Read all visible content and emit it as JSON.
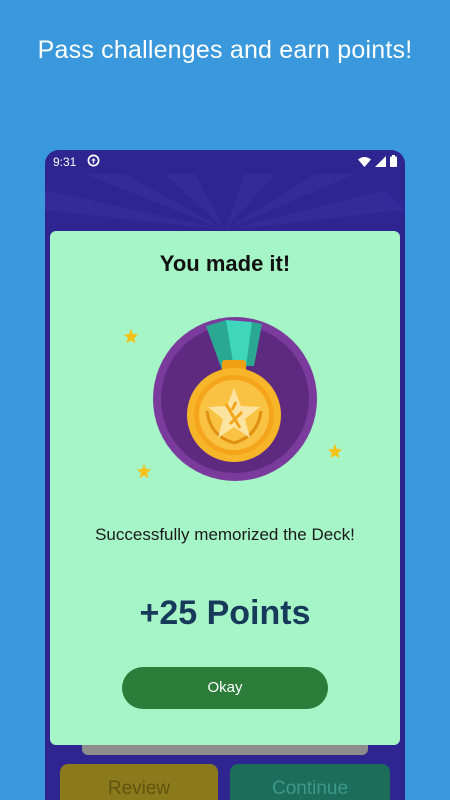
{
  "promo": {
    "title": "Pass challenges and earn points!"
  },
  "status_bar": {
    "time": "9:31",
    "icons": [
      "sync-icon",
      "wifi-icon",
      "cellular-icon",
      "battery-icon"
    ]
  },
  "dialog": {
    "title": "You made it!",
    "message": "Successfully memorized the Deck!",
    "points": "+25 Points",
    "okay_label": "Okay",
    "image": "medal-icon"
  },
  "bottom_buttons": {
    "review_label": "Review",
    "continue_label": "Continue"
  },
  "colors": {
    "background": "#3a98dc",
    "phone_bg": "#2f2590",
    "dialog_bg": "#a6f5c7",
    "okay_button": "#2d7d3a",
    "points_text": "#173a5a",
    "medal_gold": "#f7a91c",
    "medal_ribbon": "#35c9b0",
    "medal_circle": "#6a2a8a"
  }
}
